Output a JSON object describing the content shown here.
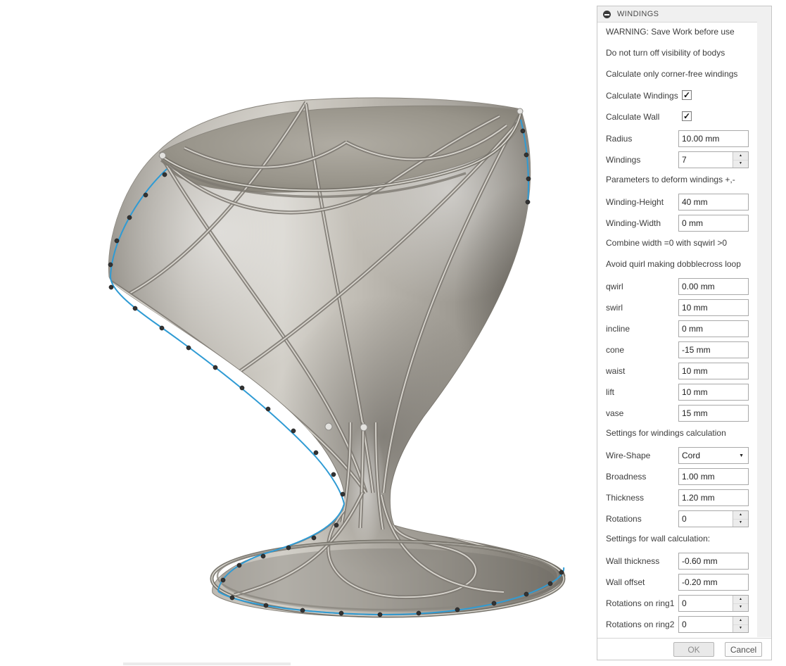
{
  "panel": {
    "title": "WINDINGS",
    "notes": {
      "warning": "WARNING: Save Work before use",
      "visibility": "Do not turn off visibility of bodys",
      "corner_free": "Calculate only corner-free windings",
      "deform": "Parameters to deform windings +,-",
      "combine": "Combine width =0 with sqwirl >0",
      "avoid": "Avoid quirl making dobblecross loop",
      "windings_calc": "Settings for windings calculation",
      "wall_calc": "Settings for wall calculation:"
    },
    "fields": {
      "calc_windings": {
        "label": "Calculate Windings",
        "checked": true
      },
      "calc_wall": {
        "label": "Calculate Wall",
        "checked": true
      },
      "radius": {
        "label": "Radius",
        "value": "10.00 mm"
      },
      "windings": {
        "label": "Windings",
        "value": "7"
      },
      "winding_height": {
        "label": "Winding-Height",
        "value": "40 mm"
      },
      "winding_width": {
        "label": "Winding-Width",
        "value": "0 mm"
      },
      "qwirl": {
        "label": "qwirl",
        "value": "0.00 mm"
      },
      "swirl": {
        "label": "swirl",
        "value": "10 mm"
      },
      "incline": {
        "label": "incline",
        "value": "0 mm"
      },
      "cone": {
        "label": "cone",
        "value": "-15 mm"
      },
      "waist": {
        "label": "waist",
        "value": "10 mm"
      },
      "lift": {
        "label": "lift",
        "value": "10 mm"
      },
      "vase": {
        "label": "vase",
        "value": "15 mm"
      },
      "wire_shape": {
        "label": "Wire-Shape",
        "value": "Cord"
      },
      "broadness": {
        "label": "Broadness",
        "value": "1.00 mm"
      },
      "thickness": {
        "label": "Thickness",
        "value": "1.20 mm"
      },
      "rotations": {
        "label": "Rotations",
        "value": "0"
      },
      "wall_thickness": {
        "label": "Wall thickness",
        "value": "-0.60 mm"
      },
      "wall_offset": {
        "label": "Wall offset",
        "value": "-0.20 mm"
      },
      "rotations_ring1": {
        "label": "Rotations on ring1",
        "value": "0"
      },
      "rotations_ring2": {
        "label": "Rotations on ring2",
        "value": "0"
      }
    },
    "buttons": {
      "ok": "OK",
      "cancel": "Cancel"
    }
  },
  "icons": {
    "collapse": "minus-circle",
    "check": "✓",
    "spin_up": "▲",
    "spin_down": "▼",
    "dropdown": "▼"
  },
  "colors": {
    "accent_spline": "#2f9bd4",
    "control_point": "#333333",
    "metal_light": "#d8d5ce",
    "metal_mid": "#b3afa7",
    "metal_dark": "#76726a",
    "panel_titlebar": "#f0f0f0",
    "panel_border": "#c6c6c6"
  }
}
